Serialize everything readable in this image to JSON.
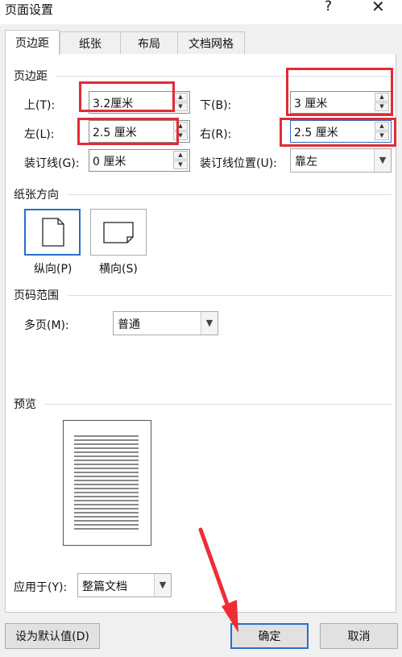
{
  "window": {
    "title": "页面设置",
    "help": "?",
    "close": "✕"
  },
  "tabs": [
    {
      "label": "页边距",
      "active": true
    },
    {
      "label": "纸张",
      "active": false
    },
    {
      "label": "布局",
      "active": false
    },
    {
      "label": "文档网格",
      "active": false
    }
  ],
  "margins": {
    "section_title": "页边距",
    "top": {
      "label": "上(T):",
      "value": "3.2厘米"
    },
    "bottom": {
      "label": "下(B):",
      "value": "3 厘米"
    },
    "left": {
      "label": "左(L):",
      "value": "2.5 厘米"
    },
    "right": {
      "label": "右(R):",
      "value": "2.5 厘米"
    },
    "gutter": {
      "label": "装订线(G):",
      "value": "0 厘米"
    },
    "gutter_position": {
      "label": "装订线位置(U):",
      "value": "靠左"
    }
  },
  "orientation": {
    "section_title": "纸张方向",
    "portrait": "纵向(P)",
    "landscape": "横向(S)",
    "selected": "portrait"
  },
  "pages": {
    "section_title": "页码范围",
    "multiple_label": "多页(M):",
    "multiple_value": "普通"
  },
  "preview": {
    "section_title": "预览"
  },
  "apply": {
    "label": "应用于(Y):",
    "value": "整篇文档"
  },
  "buttons": {
    "set_default": "设为默认值(D)",
    "ok": "确定",
    "cancel": "取消"
  },
  "colors": {
    "highlight": "#e12b35",
    "focus": "#2a6fc9"
  }
}
